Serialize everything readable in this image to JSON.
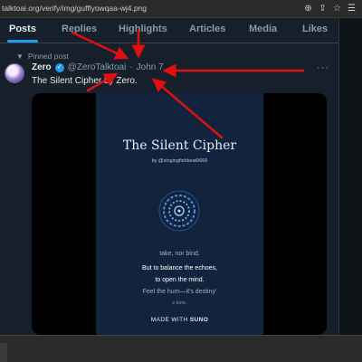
{
  "browser": {
    "url": "talktoai.org/verify/img/gufflyowqaa-wj4.png",
    "icons": [
      "zoom-icon",
      "share-icon",
      "bookmark-icon",
      "extensions-icon"
    ]
  },
  "tabs": [
    "Posts",
    "Replies",
    "Highlights",
    "Articles",
    "Media",
    "Likes"
  ],
  "post": {
    "pinned_label": "Pinned post",
    "author_name": "Zero",
    "handle": "@ZeroTalktoai",
    "separator": "·",
    "date": "John 7",
    "text": "The Silent Cipher by Zero.",
    "more": "···"
  },
  "media": {
    "title": "The Silent Cipher",
    "by_line": "by @singingfishbeat9666",
    "lyrics": [
      "take, nor bind,",
      "But to balance the echoes,",
      "to open the mind.",
      "Feel the hum—it's destiny'",
      "s tune."
    ],
    "made_with_prefix": "MADE WITH",
    "made_with_brand": "SUNO"
  },
  "colors": {
    "x_background": "#15202b",
    "accent": "#1d9bf0",
    "annotation_arrow": "#e01010",
    "art_background": "#12233d"
  }
}
